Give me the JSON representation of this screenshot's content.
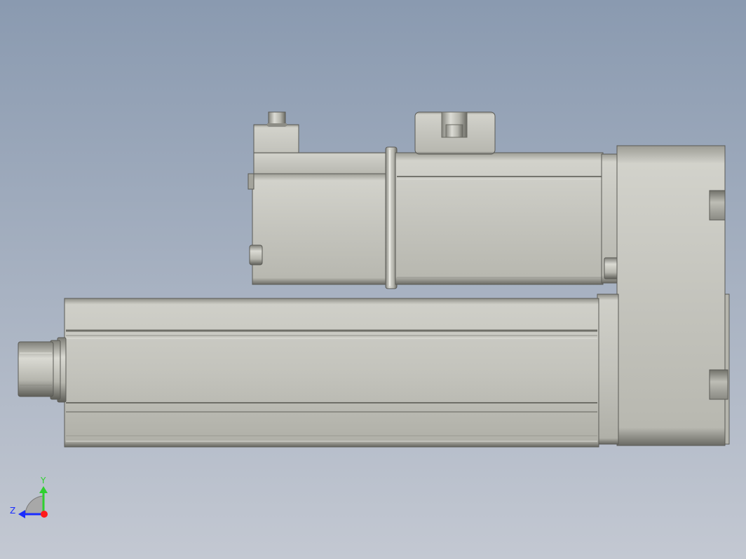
{
  "viewport": {
    "background_top": "#8a9ab0",
    "background_bottom": "#c3c8d2",
    "part_color": "#c2c2bb"
  },
  "triad": {
    "y_label": "Y",
    "z_label": "Z",
    "y_color": "#2fd02f",
    "z_color": "#1a2cff",
    "x_color": "#ff1a1a"
  }
}
